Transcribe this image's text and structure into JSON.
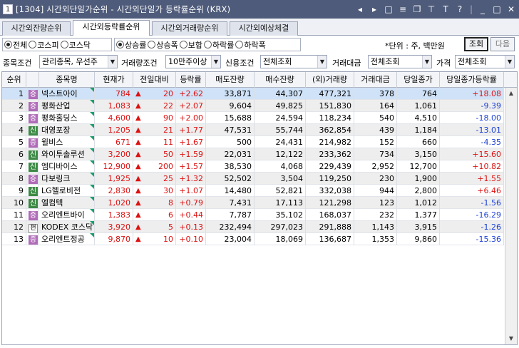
{
  "window": {
    "screen_no": "1",
    "title": "[1304] 시간외단일가순위 - 시간외단일가 등락률순위 (KRX)",
    "controls": [
      "◂",
      "▸",
      "□",
      "≡",
      "❐",
      "⊤",
      "T",
      "?",
      "|",
      "_",
      "□",
      "✕"
    ]
  },
  "tabs": [
    {
      "label": "시간외잔량순위",
      "active": false
    },
    {
      "label": "시간외등락률순위",
      "active": true
    },
    {
      "label": "시간외거래량순위",
      "active": false
    },
    {
      "label": "시간외예상체결",
      "active": false
    }
  ],
  "market_group": [
    {
      "label": "전체",
      "selected": true
    },
    {
      "label": "코스피",
      "selected": false
    },
    {
      "label": "코스닥",
      "selected": false
    }
  ],
  "sort_group": [
    {
      "label": "상승률",
      "selected": true
    },
    {
      "label": "상승폭",
      "selected": false
    },
    {
      "label": "보합",
      "selected": false
    },
    {
      "label": "하락률",
      "selected": false
    },
    {
      "label": "하락폭",
      "selected": false
    }
  ],
  "unit_text": "*단위 : 주, 백만원",
  "buttons": {
    "inquiry": "조회",
    "next": "다음"
  },
  "filters": {
    "stock_cond_label": "종목조건",
    "stock_cond_value": "관리종목, 우선주",
    "volume_cond_label": "거래량조건",
    "volume_cond_value": "10만주이상",
    "credit_cond_label": "신용조건",
    "credit_cond_value": "전체조회",
    "amount_label": "거래대금",
    "amount_value": "전체조회",
    "price_label": "가격",
    "price_value": "전체조회"
  },
  "columns": [
    "순위",
    "",
    "종목명",
    "현재가",
    "전일대비",
    "등락률",
    "매도잔량",
    "매수잔량",
    "(외)거래량",
    "거래대금",
    "당일종가",
    "당일종가등락률"
  ],
  "rows": [
    {
      "rank": "1",
      "badge": "증",
      "name": "넥스트아이",
      "price": "784",
      "change": "20",
      "rate": "+2.62",
      "ask": "33,871",
      "bid": "44,307",
      "volume": "477,321",
      "amount": "378",
      "close": "764",
      "close_rate": "+18.08",
      "close_dir": "up"
    },
    {
      "rank": "2",
      "badge": "증",
      "name": "평화산업",
      "price": "1,083",
      "change": "22",
      "rate": "+2.07",
      "ask": "9,604",
      "bid": "49,825",
      "volume": "151,830",
      "amount": "164",
      "close": "1,061",
      "close_rate": "-9.39",
      "close_dir": "down"
    },
    {
      "rank": "3",
      "badge": "증",
      "name": "평화홀딩스",
      "price": "4,600",
      "change": "90",
      "rate": "+2.00",
      "ask": "15,688",
      "bid": "24,594",
      "volume": "118,234",
      "amount": "540",
      "close": "4,510",
      "close_rate": "-18.00",
      "close_dir": "down"
    },
    {
      "rank": "4",
      "badge": "신",
      "name": "대영포장",
      "price": "1,205",
      "change": "21",
      "rate": "+1.77",
      "ask": "47,531",
      "bid": "55,744",
      "volume": "362,854",
      "amount": "439",
      "close": "1,184",
      "close_rate": "-13.01",
      "close_dir": "down"
    },
    {
      "rank": "5",
      "badge": "증",
      "name": "윌비스",
      "price": "671",
      "change": "11",
      "rate": "+1.67",
      "ask": "500",
      "bid": "24,431",
      "volume": "214,982",
      "amount": "152",
      "close": "660",
      "close_rate": "-4.35",
      "close_dir": "down"
    },
    {
      "rank": "6",
      "badge": "신",
      "name": "와이투솔루션",
      "price": "3,200",
      "change": "50",
      "rate": "+1.59",
      "ask": "22,031",
      "bid": "12,122",
      "volume": "233,362",
      "amount": "734",
      "close": "3,150",
      "close_rate": "+15.60",
      "close_dir": "up"
    },
    {
      "rank": "7",
      "badge": "신",
      "name": "엠디바이스",
      "price": "12,900",
      "change": "200",
      "rate": "+1.57",
      "ask": "38,530",
      "bid": "4,068",
      "volume": "229,439",
      "amount": "2,952",
      "close": "12,700",
      "close_rate": "+10.82",
      "close_dir": "up"
    },
    {
      "rank": "8",
      "badge": "증",
      "name": "다보링크",
      "price": "1,925",
      "change": "25",
      "rate": "+1.32",
      "ask": "52,502",
      "bid": "3,504",
      "volume": "119,250",
      "amount": "230",
      "close": "1,900",
      "close_rate": "+1.55",
      "close_dir": "up"
    },
    {
      "rank": "9",
      "badge": "신",
      "name": "LG헬로비전",
      "price": "2,830",
      "change": "30",
      "rate": "+1.07",
      "ask": "14,480",
      "bid": "52,821",
      "volume": "332,038",
      "amount": "944",
      "close": "2,800",
      "close_rate": "+6.46",
      "close_dir": "up"
    },
    {
      "rank": "10",
      "badge": "신",
      "name": "엘컴텍",
      "price": "1,020",
      "change": "8",
      "rate": "+0.79",
      "ask": "7,431",
      "bid": "17,113",
      "volume": "121,298",
      "amount": "123",
      "close": "1,012",
      "close_rate": "-1.56",
      "close_dir": "down"
    },
    {
      "rank": "11",
      "badge": "증",
      "name": "오리엔트바이",
      "price": "1,383",
      "change": "6",
      "rate": "+0.44",
      "ask": "7,787",
      "bid": "35,102",
      "volume": "168,037",
      "amount": "232",
      "close": "1,377",
      "close_rate": "-16.29",
      "close_dir": "down"
    },
    {
      "rank": "12",
      "badge": "펀",
      "name": "KODEX 코스닥",
      "price": "3,920",
      "change": "5",
      "rate": "+0.13",
      "ask": "232,494",
      "bid": "297,023",
      "volume": "291,888",
      "amount": "1,143",
      "close": "3,915",
      "close_rate": "-1.26",
      "close_dir": "down"
    },
    {
      "rank": "13",
      "badge": "증",
      "name": "오리엔트정공",
      "price": "9,870",
      "change": "10",
      "rate": "+0.10",
      "ask": "23,004",
      "bid": "18,069",
      "volume": "136,687",
      "amount": "1,353",
      "close": "9,860",
      "close_rate": "-15.36",
      "close_dir": "down"
    }
  ],
  "colors": {
    "titlebar": "#4e5b7a",
    "up": "#d11111",
    "down": "#1a3fd6",
    "selected_row": "#cfe2f7"
  }
}
